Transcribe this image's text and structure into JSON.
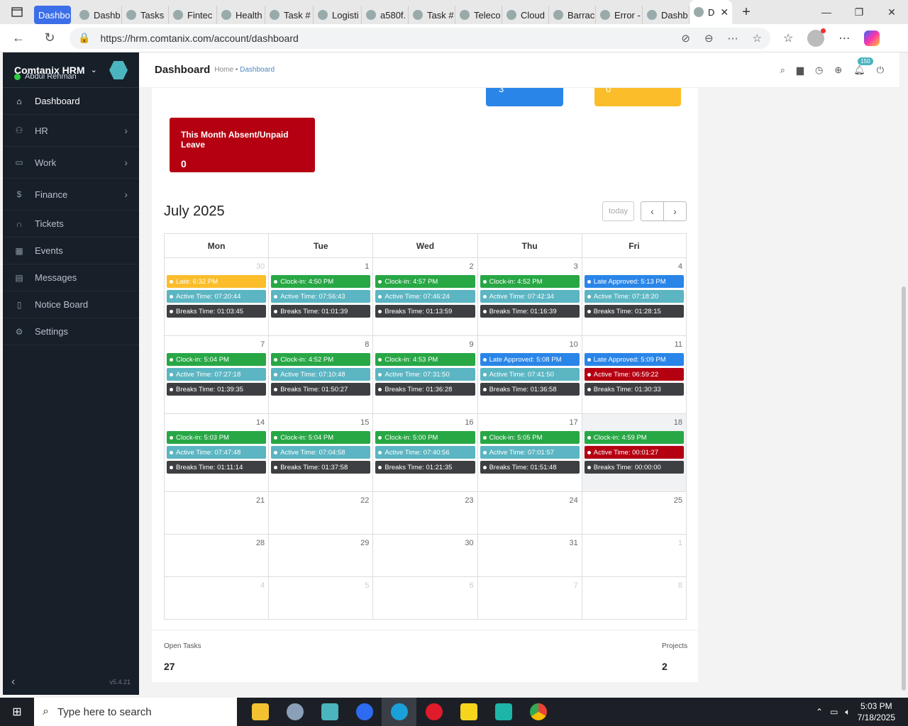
{
  "browser": {
    "tabs": [
      "Dashbo",
      "Dashb",
      "Tasks",
      "Fintec",
      "Health",
      "Task #",
      "Logisti",
      "a580f.",
      "Task #",
      "Teleco",
      "Cloud",
      "Barrac",
      "Error -",
      "Dashb",
      "D"
    ],
    "url": "https://hrm.comtanix.com/account/dashboard"
  },
  "sidebar": {
    "brand": "Comtanix HRM",
    "user": "Abdul Rehman",
    "items": [
      {
        "label": "Dashboard",
        "icon": "home-icon"
      },
      {
        "label": "HR",
        "icon": "users-icon"
      },
      {
        "label": "Work",
        "icon": "briefcase-icon"
      },
      {
        "label": "Finance",
        "icon": "dollar-icon"
      },
      {
        "label": "Tickets",
        "icon": "headset-icon"
      },
      {
        "label": "Events",
        "icon": "calendar-icon"
      },
      {
        "label": "Messages",
        "icon": "message-icon"
      },
      {
        "label": "Notice Board",
        "icon": "clipboard-icon"
      },
      {
        "label": "Settings",
        "icon": "gear-icon"
      }
    ],
    "version": "v5.4.21"
  },
  "topbar": {
    "title": "Dashboard",
    "crumb_home": "Home",
    "crumb_sep": "•",
    "crumb_current": "Dashboard",
    "notif_count": "150"
  },
  "cards": {
    "blue_value": "3",
    "yellow_value": "0",
    "absent_label": "This Month Absent/Unpaid Leave",
    "absent_value": "0"
  },
  "calendar": {
    "title": "July 2025",
    "today_btn": "today",
    "days": [
      "Mon",
      "Tue",
      "Wed",
      "Thu",
      "Fri"
    ],
    "weeks": [
      [
        {
          "d": "30",
          "other": true,
          "ev": [
            [
              "yellow",
              "Late: 6:32 PM"
            ],
            [
              "teal",
              "Active Time: 07:20:44"
            ],
            [
              "dark",
              "Breaks Time: 01:03:45"
            ]
          ]
        },
        {
          "d": "1",
          "ev": [
            [
              "green",
              "Clock-in: 4:50 PM"
            ],
            [
              "teal",
              "Active Time: 07:56:43"
            ],
            [
              "dark",
              "Breaks Time: 01:01:39"
            ]
          ]
        },
        {
          "d": "2",
          "ev": [
            [
              "green",
              "Clock-in: 4:57 PM"
            ],
            [
              "teal",
              "Active Time: 07:46:24"
            ],
            [
              "dark",
              "Breaks Time: 01:13:59"
            ]
          ]
        },
        {
          "d": "3",
          "ev": [
            [
              "green",
              "Clock-in: 4:52 PM"
            ],
            [
              "teal",
              "Active Time: 07:42:34"
            ],
            [
              "dark",
              "Breaks Time: 01:16:39"
            ]
          ]
        },
        {
          "d": "4",
          "ev": [
            [
              "blue",
              "Late Approved: 5:13 PM"
            ],
            [
              "teal",
              "Active Time: 07:18:20"
            ],
            [
              "dark",
              "Breaks Time: 01:28:15"
            ]
          ]
        }
      ],
      [
        {
          "d": "7",
          "ev": [
            [
              "green",
              "Clock-in: 5:04 PM"
            ],
            [
              "teal",
              "Active Time: 07:27:18"
            ],
            [
              "dark",
              "Breaks Time: 01:39:35"
            ]
          ]
        },
        {
          "d": "8",
          "ev": [
            [
              "green",
              "Clock-in: 4:52 PM"
            ],
            [
              "teal",
              "Active Time: 07:10:48"
            ],
            [
              "dark",
              "Breaks Time: 01:50:27"
            ]
          ]
        },
        {
          "d": "9",
          "ev": [
            [
              "green",
              "Clock-in: 4:53 PM"
            ],
            [
              "teal",
              "Active Time: 07:31:50"
            ],
            [
              "dark",
              "Breaks Time: 01:36:28"
            ]
          ]
        },
        {
          "d": "10",
          "ev": [
            [
              "blue",
              "Late Approved: 5:08 PM"
            ],
            [
              "teal",
              "Active Time: 07:41:50"
            ],
            [
              "dark",
              "Breaks Time: 01:36:58"
            ]
          ]
        },
        {
          "d": "11",
          "ev": [
            [
              "blue",
              "Late Approved: 5:09 PM"
            ],
            [
              "red",
              "Active Time: 06:59:22"
            ],
            [
              "dark",
              "Breaks Time: 01:30:33"
            ]
          ]
        }
      ],
      [
        {
          "d": "14",
          "ev": [
            [
              "green",
              "Clock-in: 5:03 PM"
            ],
            [
              "teal",
              "Active Time: 07:47:48"
            ],
            [
              "dark",
              "Breaks Time: 01:11:14"
            ]
          ]
        },
        {
          "d": "15",
          "ev": [
            [
              "green",
              "Clock-in: 5:04 PM"
            ],
            [
              "teal",
              "Active Time: 07:04:58"
            ],
            [
              "dark",
              "Breaks Time: 01:37:58"
            ]
          ]
        },
        {
          "d": "16",
          "ev": [
            [
              "green",
              "Clock-in: 5:00 PM"
            ],
            [
              "teal",
              "Active Time: 07:40:56"
            ],
            [
              "dark",
              "Breaks Time: 01:21:35"
            ]
          ]
        },
        {
          "d": "17",
          "ev": [
            [
              "green",
              "Clock-in: 5:05 PM"
            ],
            [
              "teal",
              "Active Time: 07:01:57"
            ],
            [
              "dark",
              "Breaks Time: 01:51:48"
            ]
          ]
        },
        {
          "d": "18",
          "today": true,
          "ev": [
            [
              "green",
              "Clock-in: 4:59 PM"
            ],
            [
              "red",
              "Active Time: 00:01:27"
            ],
            [
              "dark",
              "Breaks Time: 00:00:00"
            ]
          ]
        }
      ],
      [
        {
          "d": "21",
          "ev": []
        },
        {
          "d": "22",
          "ev": []
        },
        {
          "d": "23",
          "ev": []
        },
        {
          "d": "24",
          "ev": []
        },
        {
          "d": "25",
          "ev": []
        }
      ],
      [
        {
          "d": "28",
          "ev": []
        },
        {
          "d": "29",
          "ev": []
        },
        {
          "d": "30",
          "ev": []
        },
        {
          "d": "31",
          "ev": []
        },
        {
          "d": "1",
          "other": true,
          "ev": []
        }
      ],
      [
        {
          "d": "4",
          "other": true,
          "ev": []
        },
        {
          "d": "5",
          "other": true,
          "ev": []
        },
        {
          "d": "6",
          "other": true,
          "ev": []
        },
        {
          "d": "7",
          "other": true,
          "ev": []
        },
        {
          "d": "8",
          "other": true,
          "ev": []
        }
      ]
    ]
  },
  "stats": {
    "open_tasks_label": "Open Tasks",
    "open_tasks_value": "27",
    "projects_label": "Projects",
    "projects_value": "2"
  },
  "taskbar": {
    "search_placeholder": "Type here to search",
    "time": "5:03 PM",
    "date": "7/18/2025"
  },
  "colors": {
    "sidebar_bg": "#171f29",
    "accent": "#4ab4bf",
    "green": "#28a745",
    "teal": "#5bb5c2",
    "blue": "#2a85e8",
    "yellow": "#fbbd2a",
    "red": "#b50012"
  }
}
